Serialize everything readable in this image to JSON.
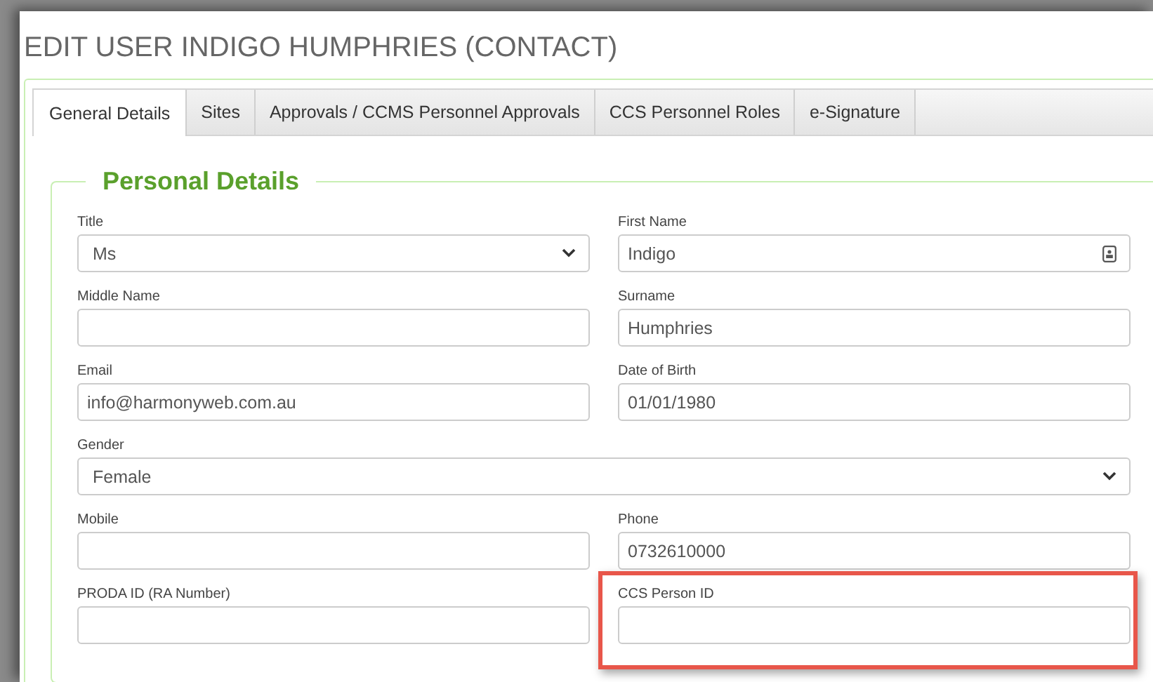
{
  "page_title": "EDIT USER INDIGO HUMPHRIES (CONTACT)",
  "tabs": [
    {
      "label": "General Details",
      "selected": true
    },
    {
      "label": "Sites",
      "selected": false
    },
    {
      "label": "Approvals / CCMS Personnel Approvals",
      "selected": false
    },
    {
      "label": "CCS Personnel Roles",
      "selected": false
    },
    {
      "label": "e-Signature",
      "selected": false
    }
  ],
  "section": {
    "legend": "Personal Details",
    "rows": [
      [
        {
          "label": "Title",
          "kind": "select",
          "value": "Ms"
        },
        {
          "label": "First Name",
          "kind": "text",
          "value": "Indigo",
          "contact_icon": true
        }
      ],
      [
        {
          "label": "Middle Name",
          "kind": "text"
        },
        {
          "label": "Surname",
          "kind": "text",
          "value": "Humphries"
        }
      ],
      [
        {
          "label": "Email",
          "kind": "text",
          "value": "info@harmonyweb.com.au"
        },
        {
          "label": "Date of Birth",
          "kind": "text",
          "value": "01/01/1980"
        }
      ],
      [
        {
          "label": "Gender",
          "kind": "select",
          "value": "Female"
        }
      ],
      [
        {
          "label": "Mobile",
          "kind": "text"
        },
        {
          "label": "Phone",
          "kind": "text",
          "value": "0732610000"
        }
      ],
      [
        {
          "label": "PRODA ID (RA Number)",
          "kind": "text"
        },
        {
          "label": "CCS Person ID",
          "kind": "text",
          "highlighted": true
        }
      ]
    ]
  }
}
